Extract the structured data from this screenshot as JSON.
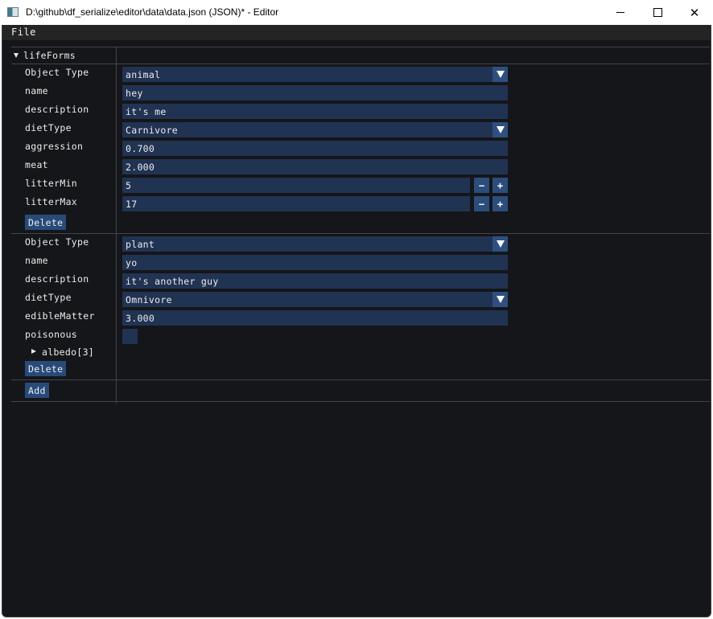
{
  "window": {
    "title": "D:\\github\\df_serialize\\editor\\data\\data.json (JSON)* - Editor",
    "icon": "app-window-icon",
    "controls": {
      "minimize": "minimize-icon",
      "maximize": "maximize-icon",
      "close": "close-icon",
      "close_glyph": "✕"
    }
  },
  "menu": {
    "file_label": "File"
  },
  "tree": {
    "root_label": "lifeForms",
    "root_expanded": true,
    "entries": [
      {
        "object_type_label": "Object Type",
        "object_type_value": "animal",
        "fields": {
          "name": {
            "label": "name",
            "value": "hey"
          },
          "description": {
            "label": "description",
            "value": "it's me"
          },
          "dietType": {
            "label": "dietType",
            "value": "Carnivore"
          },
          "aggression": {
            "label": "aggression",
            "value": "0.700"
          },
          "meat": {
            "label": "meat",
            "value": "2.000"
          },
          "litterMin": {
            "label": "litterMin",
            "value": "5"
          },
          "litterMax": {
            "label": "litterMax",
            "value": "17"
          }
        },
        "delete_label": "Delete"
      },
      {
        "object_type_label": "Object Type",
        "object_type_value": "plant",
        "fields": {
          "name": {
            "label": "name",
            "value": "yo"
          },
          "description": {
            "label": "description",
            "value": "it's another guy"
          },
          "dietType": {
            "label": "dietType",
            "value": "Omnivore"
          },
          "edibleMatter": {
            "label": "edibleMatter",
            "value": "3.000"
          },
          "poisonous": {
            "label": "poisonous",
            "checked": false
          },
          "albedo": {
            "label": "albedo[3]",
            "expanded": false
          }
        },
        "delete_label": "Delete"
      }
    ],
    "add_label": "Add"
  },
  "stepper": {
    "minus": "−",
    "plus": "+"
  },
  "colors": {
    "background": "#151619",
    "field": "#213352",
    "button": "#284a79",
    "combo_arrow": "#2d5080",
    "separator": "#43444a",
    "menubar": "#242424"
  }
}
